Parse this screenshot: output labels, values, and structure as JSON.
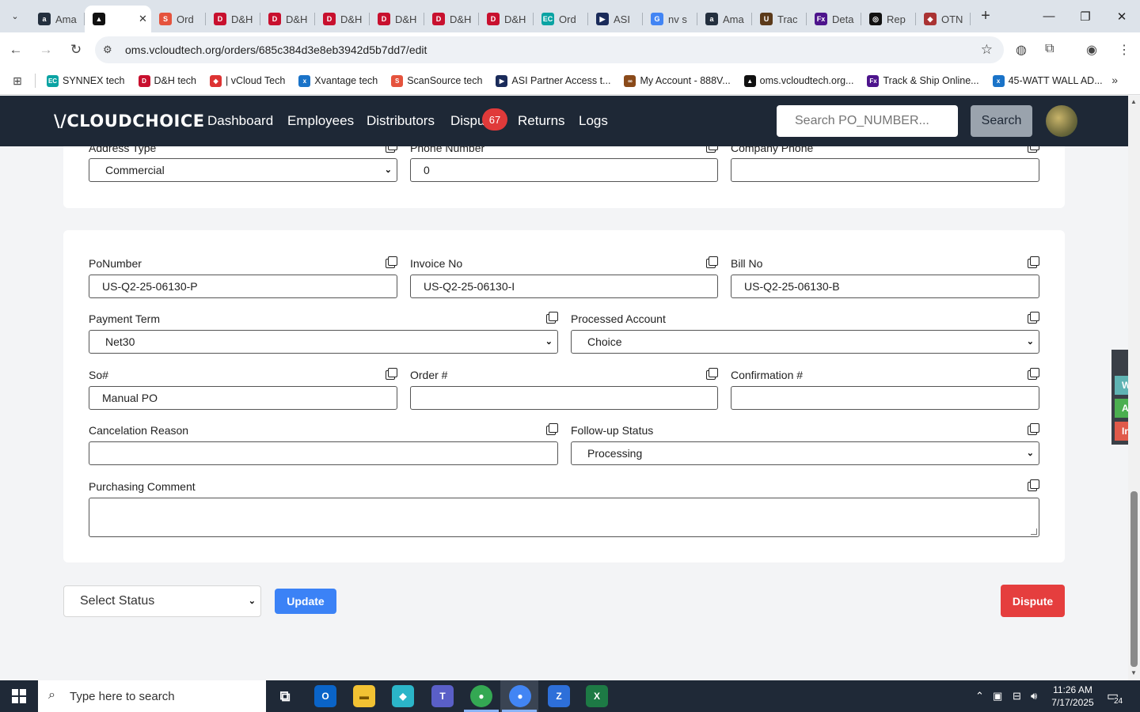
{
  "browser": {
    "tabs": [
      {
        "title": "Ama",
        "fav": "a",
        "color": "#232f3e"
      },
      {
        "title": "",
        "fav": "▲",
        "color": "#111111",
        "active": true
      },
      {
        "title": "Ord",
        "fav": "S",
        "color": "#e5533d"
      },
      {
        "title": "D&H",
        "fav": "D",
        "color": "#c8102e"
      },
      {
        "title": "D&H",
        "fav": "D",
        "color": "#c8102e"
      },
      {
        "title": "D&H",
        "fav": "D",
        "color": "#c8102e"
      },
      {
        "title": "D&H",
        "fav": "D",
        "color": "#c8102e"
      },
      {
        "title": "D&H",
        "fav": "D",
        "color": "#c8102e"
      },
      {
        "title": "D&H",
        "fav": "D",
        "color": "#c8102e"
      },
      {
        "title": "Ord",
        "fav": "EC",
        "color": "#0aa3a3"
      },
      {
        "title": "ASI",
        "fav": "▶",
        "color": "#1a2b5a"
      },
      {
        "title": "nv s",
        "fav": "G",
        "color": "#4285f4"
      },
      {
        "title": "Ama",
        "fav": "a",
        "color": "#232f3e"
      },
      {
        "title": "Trac",
        "fav": "U",
        "color": "#5b3a1a"
      },
      {
        "title": "Deta",
        "fav": "Fx",
        "color": "#4d148c"
      },
      {
        "title": "Rep",
        "fav": "◎",
        "color": "#111111"
      },
      {
        "title": "OTN",
        "fav": "◆",
        "color": "#a33"
      }
    ],
    "url": "oms.vcloudtech.org/orders/685c384d3e8eb3942d5b7dd7/edit",
    "bookmarks": [
      {
        "label": "SYNNEX tech",
        "fav": "EC",
        "color": "#0aa3a3"
      },
      {
        "label": "D&H tech",
        "fav": "D",
        "color": "#c8102e"
      },
      {
        "label": "| vCloud Tech",
        "fav": "◆",
        "color": "#d33"
      },
      {
        "label": "Xvantage tech",
        "fav": "x",
        "color": "#1a73c8"
      },
      {
        "label": "ScanSource tech",
        "fav": "S",
        "color": "#e5533d"
      },
      {
        "label": "ASI Partner Access t...",
        "fav": "▶",
        "color": "#1a2b5a"
      },
      {
        "label": "My Account - 888V...",
        "fav": "∞",
        "color": "#8a4a1a"
      },
      {
        "label": "oms.vcloudtech.org...",
        "fav": "▲",
        "color": "#111111"
      },
      {
        "label": "Track & Ship Online...",
        "fav": "Fx",
        "color": "#4d148c"
      },
      {
        "label": "45-WATT WALL AD...",
        "fav": "x",
        "color": "#1a73c8"
      }
    ]
  },
  "app": {
    "logo": "\\/CLOUDCHOICE",
    "nav": [
      {
        "label": "Dashboard"
      },
      {
        "label": "Employees"
      },
      {
        "label": "Distributors"
      },
      {
        "label": "Dispu"
      },
      {
        "label": "Returns"
      },
      {
        "label": "Logs"
      }
    ],
    "disputes_badge": "67",
    "search_placeholder": "Search PO_NUMBER...",
    "search_button": "Search"
  },
  "address_card": {
    "address_type_label": "Address Type",
    "address_type_value": "Commercial",
    "phone_label": "Phone Number",
    "phone_value": "0",
    "company_phone_label": "Company Phone",
    "company_phone_value": ""
  },
  "order_card": {
    "po_label": "PoNumber",
    "po_value": "US-Q2-25-06130-P",
    "invoice_label": "Invoice No",
    "invoice_value": "US-Q2-25-06130-I",
    "bill_label": "Bill No",
    "bill_value": "US-Q2-25-06130-B",
    "payment_term_label": "Payment Term",
    "payment_term_value": "Net30",
    "processed_account_label": "Processed Account",
    "processed_account_value": "Choice",
    "so_label": "So#",
    "so_value": "Manual PO",
    "order_label": "Order #",
    "order_value": "",
    "confirmation_label": "Confirmation #",
    "confirmation_value": "",
    "cancel_reason_label": "Cancelation Reason",
    "cancel_reason_value": "",
    "followup_label": "Follow-up Status",
    "followup_value": "Processing",
    "comment_label": "Purchasing Comment",
    "comment_value": ""
  },
  "actions": {
    "status_select": "Select Status",
    "update": "Update",
    "dispute": "Dispute"
  },
  "side_panel": [
    {
      "label": "Wor",
      "color": "#5fb3b3"
    },
    {
      "label": "Acti",
      "color": "#4caf50"
    },
    {
      "label": "In A",
      "color": "#e05a4a"
    }
  ],
  "taskbar": {
    "search_placeholder": "Type here to search",
    "time": "11:26 AM",
    "date": "7/17/2025",
    "notification_count": "24"
  }
}
